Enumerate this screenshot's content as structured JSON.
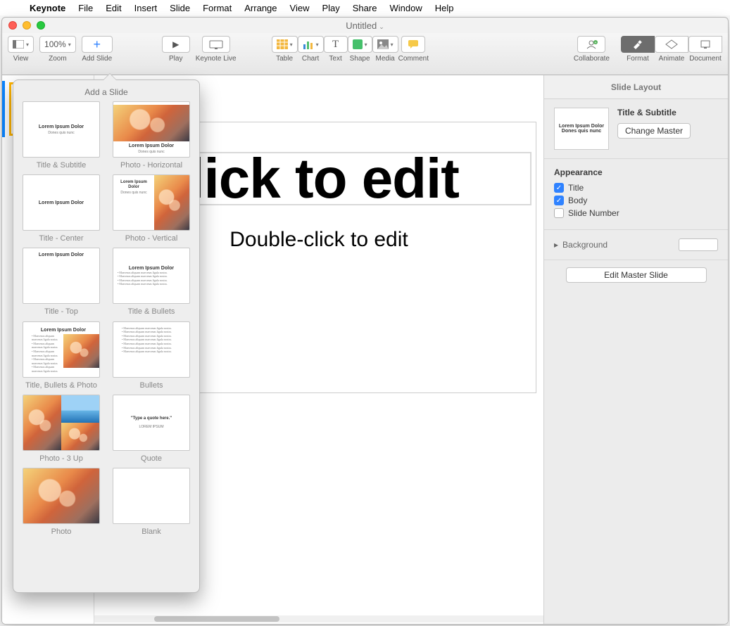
{
  "menu": {
    "apple": "",
    "app": "Keynote",
    "items": [
      "File",
      "Edit",
      "Insert",
      "Slide",
      "Format",
      "Arrange",
      "View",
      "Play",
      "Share",
      "Window",
      "Help"
    ]
  },
  "window": {
    "title": "Untitled"
  },
  "toolbar": {
    "view": "View",
    "zoom": "Zoom",
    "zoom_value": "100%",
    "add_slide": "Add Slide",
    "play": "Play",
    "keynote_live": "Keynote Live",
    "table": "Table",
    "chart": "Chart",
    "text": "Text",
    "shape": "Shape",
    "media": "Media",
    "comment": "Comment",
    "collaborate": "Collaborate",
    "format": "Format",
    "animate": "Animate",
    "document": "Document"
  },
  "popover": {
    "title": "Add a Slide",
    "items": [
      {
        "label": "Title & Subtitle",
        "variant": "title_sub"
      },
      {
        "label": "Photo - Horizontal",
        "variant": "photo_h"
      },
      {
        "label": "Title - Center",
        "variant": "title_center"
      },
      {
        "label": "Photo - Vertical",
        "variant": "photo_v"
      },
      {
        "label": "Title - Top",
        "variant": "title_top"
      },
      {
        "label": "Title & Bullets",
        "variant": "title_bullets"
      },
      {
        "label": "Title, Bullets & Photo",
        "variant": "title_bullets_photo"
      },
      {
        "label": "Bullets",
        "variant": "bullets"
      },
      {
        "label": "Photo - 3 Up",
        "variant": "photo3"
      },
      {
        "label": "Quote",
        "variant": "quote"
      },
      {
        "label": "Photo",
        "variant": "photo"
      },
      {
        "label": "Blank",
        "variant": "blank"
      }
    ],
    "lorem": "Lorem Ipsum Dolor",
    "lorem_sub": "Dones quis nunc",
    "quote_text": "\"Type a quote here.\"",
    "quote_attr": "LOREM IPSUM"
  },
  "canvas": {
    "title_placeholder": "Double-click to edit",
    "subtitle_placeholder": "Double-click to edit"
  },
  "inspector": {
    "panel_title": "Slide Layout",
    "layout_name": "Title & Subtitle",
    "change_master": "Change Master",
    "appearance": "Appearance",
    "chk_title": "Title",
    "chk_body": "Body",
    "chk_slidenum": "Slide Number",
    "background": "Background",
    "edit_master": "Edit Master Slide"
  }
}
